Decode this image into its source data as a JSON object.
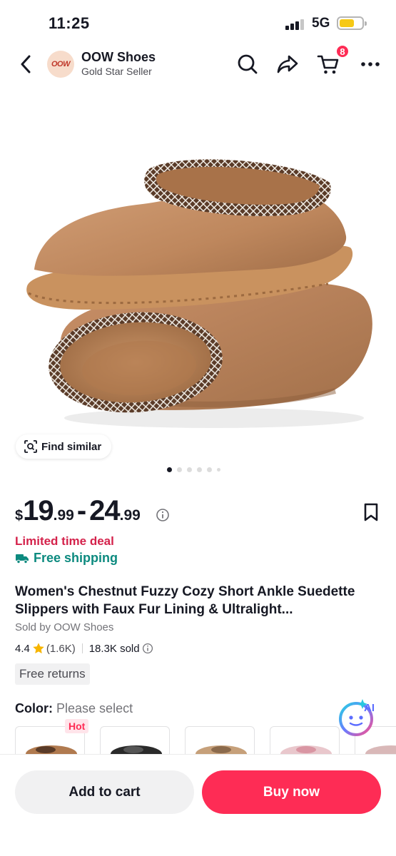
{
  "status_bar": {
    "time": "11:25",
    "network": "5G"
  },
  "header": {
    "shop_name": "OOW Shoes",
    "shop_badge": "Gold Star Seller",
    "logo_text": "OOW",
    "cart_count": "8",
    "icons": [
      "back-arrow-icon",
      "search-icon",
      "share-icon",
      "cart-icon",
      "more-icon"
    ]
  },
  "gallery": {
    "find_similar_label": "Find similar",
    "image_count": 6,
    "active_index": 0
  },
  "price": {
    "currency": "$",
    "min_whole": "19",
    "min_cents": ".99",
    "separator": "-",
    "max_whole": "24",
    "max_cents": ".99"
  },
  "promo": {
    "deal": "Limited time deal",
    "shipping": "Free shipping"
  },
  "product": {
    "title": "Women's Chestnut Fuzzy Cozy Short Ankle Suedette Slippers with Faux Fur Lining & Ultralight...",
    "sold_by": "Sold by OOW Shoes",
    "rating": "4.4",
    "review_count": "(1.6K)",
    "sold": "18.3K sold",
    "free_returns": "Free returns"
  },
  "color": {
    "label": "Color:",
    "value": "Please select",
    "hot_badge": "Hot",
    "ai_label": "AI"
  },
  "actions": {
    "add_to_cart": "Add to cart",
    "buy_now": "Buy now"
  },
  "colors": {
    "accent": "#fe2c55",
    "deal": "#d4224b",
    "shipping": "#0c8a7f",
    "star": "#f7b500"
  }
}
